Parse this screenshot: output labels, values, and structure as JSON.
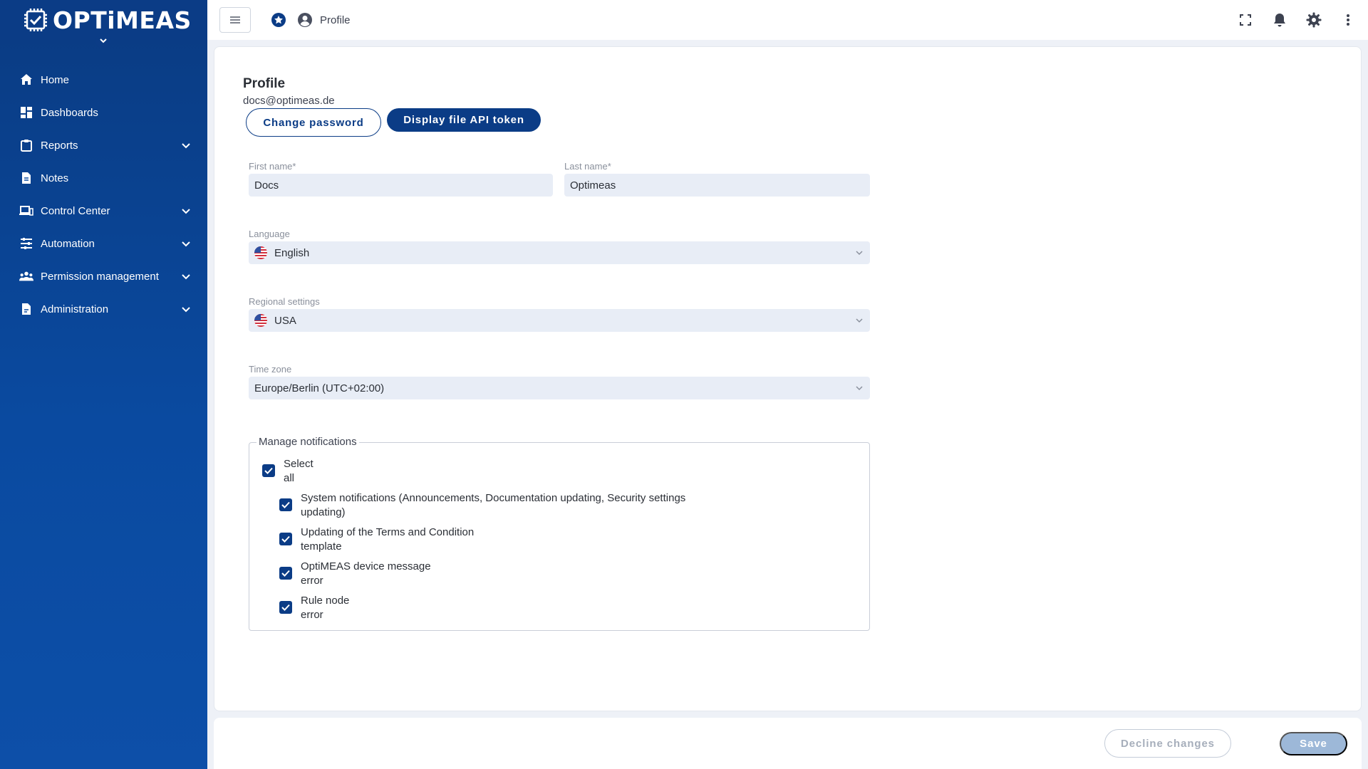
{
  "brand": {
    "name": "OPTiMEAS",
    "primary_color": "#0b3c86"
  },
  "sidebar": {
    "items": [
      {
        "label": "Home",
        "icon": "home-icon",
        "expandable": false
      },
      {
        "label": "Dashboards",
        "icon": "dashboard-icon",
        "expandable": false
      },
      {
        "label": "Reports",
        "icon": "clipboard-icon",
        "expandable": true
      },
      {
        "label": "Notes",
        "icon": "document-icon",
        "expandable": false
      },
      {
        "label": "Control Center",
        "icon": "devices-icon",
        "expandable": true
      },
      {
        "label": "Automation",
        "icon": "sliders-icon",
        "expandable": true
      },
      {
        "label": "Permission management",
        "icon": "people-icon",
        "expandable": true
      },
      {
        "label": "Administration",
        "icon": "admin-document-icon",
        "expandable": true
      }
    ]
  },
  "topbar": {
    "breadcrumb": "Profile",
    "actions": [
      "fullscreen-icon",
      "bell-icon",
      "gear-icon",
      "more-vertical-icon"
    ]
  },
  "profile": {
    "title": "Profile",
    "email": "docs@optimeas.de",
    "change_password_label": "Change password",
    "api_token_label": "Display file API token",
    "first_name": {
      "label": "First name*",
      "value": "Docs"
    },
    "last_name": {
      "label": "Last name*",
      "value": "Optimeas"
    },
    "language": {
      "label": "Language",
      "value": "English"
    },
    "regional": {
      "label": "Regional settings",
      "value": "USA"
    },
    "timezone": {
      "label": "Time zone",
      "value": "Europe/Berlin (UTC+02:00)"
    }
  },
  "notifications": {
    "legend": "Manage notifications",
    "select_all": {
      "line1": "Select",
      "line2": "all",
      "checked": true
    },
    "items": [
      {
        "line1": "System notifications (Announcements, Documentation updating, Security settings",
        "line2": "updating)",
        "checked": true
      },
      {
        "line1": "Updating of the Terms and Condition",
        "line2": "template",
        "checked": true
      },
      {
        "line1": "OptiMEAS device message",
        "line2": "error",
        "checked": true
      },
      {
        "line1": "Rule node",
        "line2": "error",
        "checked": true
      }
    ]
  },
  "footer": {
    "decline_label": "Decline changes",
    "save_label": "Save"
  }
}
